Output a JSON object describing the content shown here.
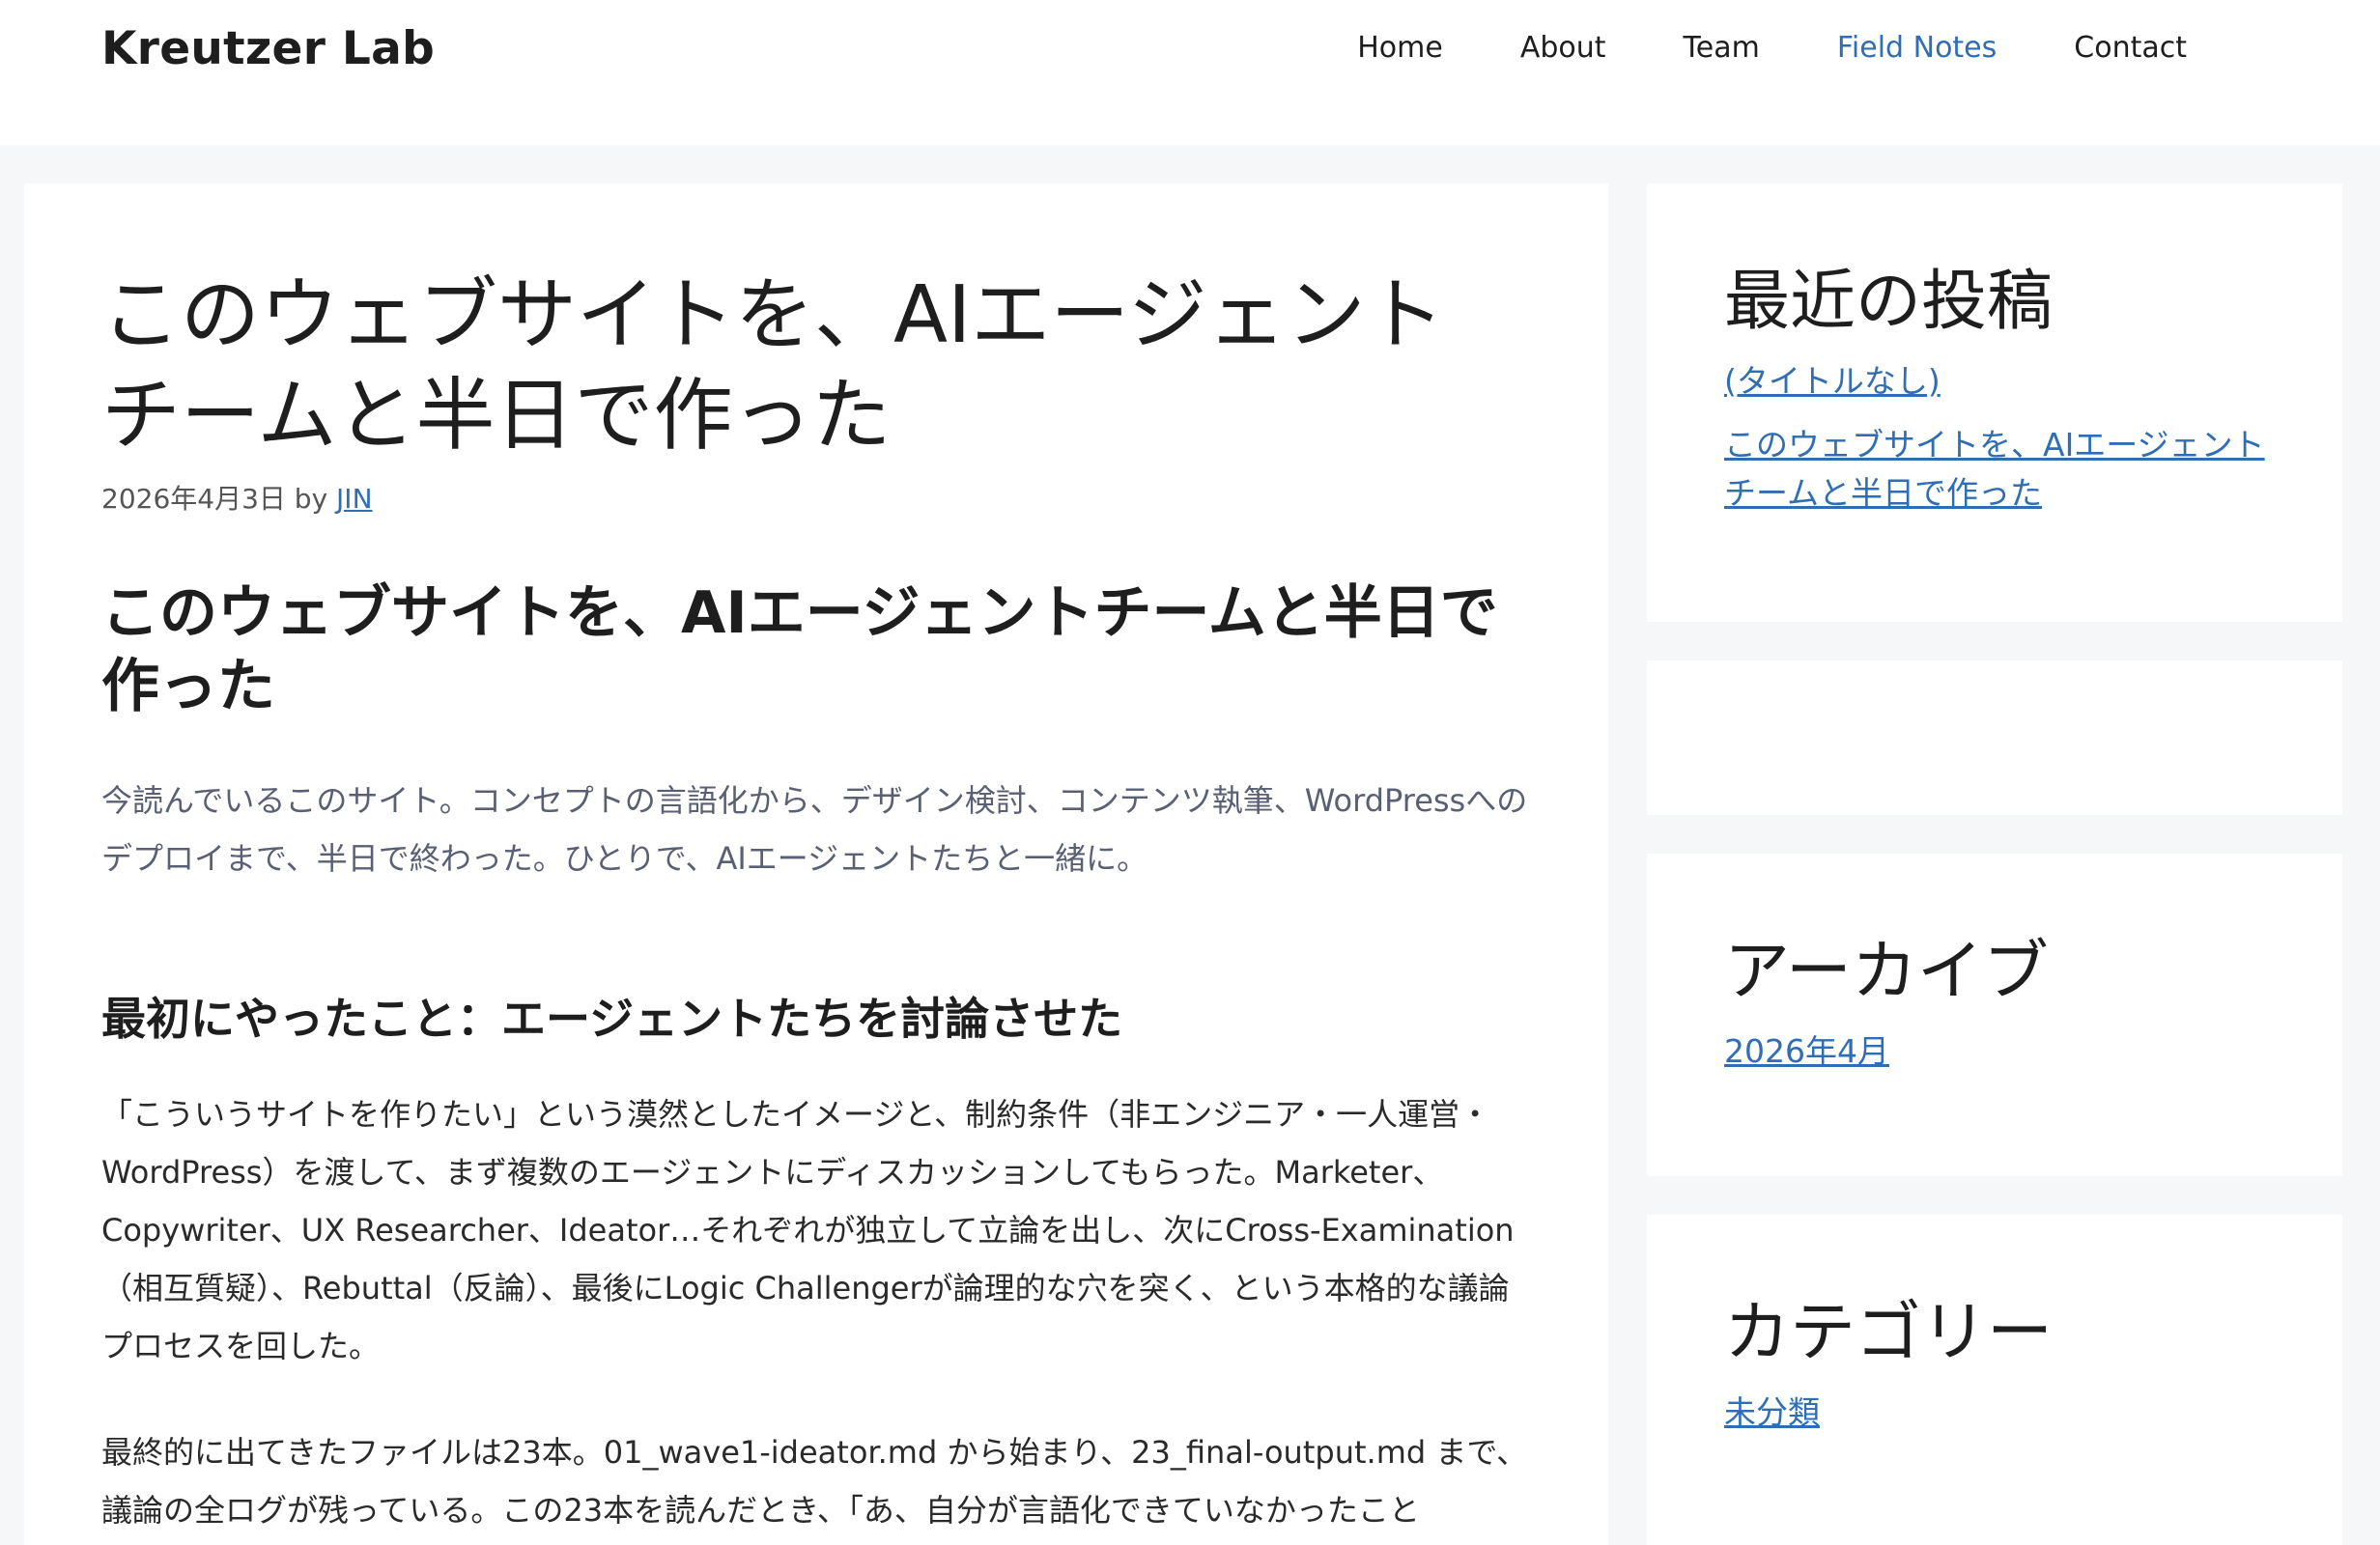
{
  "site": {
    "title": "Kreutzer Lab"
  },
  "nav": {
    "items": [
      {
        "label": "Home",
        "current": false
      },
      {
        "label": "About",
        "current": false
      },
      {
        "label": "Team",
        "current": false
      },
      {
        "label": "Field Notes",
        "current": true
      },
      {
        "label": "Contact",
        "current": false
      }
    ]
  },
  "post": {
    "title": "このウェブサイトを、AIエージェントチームと半日で作った",
    "date": "2026年4月3日",
    "by": "by",
    "author": "JIN",
    "heading": "このウェブサイトを、AIエージェントチームと半日で作った",
    "lead": "今読んでいるこのサイト。コンセプトの言語化から、デザイン検討、コンテンツ執筆、WordPressへのデプロイまで、半日で終わった。ひとりで、AIエージェントたちと一緒に。",
    "section_heading": "最初にやったこと：エージェントたちを討論させた",
    "paragraph1": "「こういうサイトを作りたい」という漠然としたイメージと、制約条件（非エンジニア・一人運営・WordPress）を渡して、まず複数のエージェントにディスカッションしてもらった。Marketer、Copywriter、UX Researcher、Ideator…それぞれが独立して立論を出し、次にCross-Examination（相互質疑）、Rebuttal（反論）、最後にLogic Challengerが論理的な穴を突く、という本格的な議論プロセスを回した。",
    "paragraph2": "最終的に出てきたファイルは23本。01_wave1-ideator.md から始まり、23_final-output.md まで、議論の全ログが残っている。この23本を読んだとき、「あ、自分が言語化できていなかったこと"
  },
  "sidebar": {
    "recent": {
      "title": "最近の投稿",
      "items": [
        "(タイトルなし)",
        "このウェブサイトを、AIエージェントチームと半日で作った"
      ]
    },
    "archives": {
      "title": "アーカイブ",
      "items": [
        "2026年4月"
      ]
    },
    "categories": {
      "title": "カテゴリー",
      "items": [
        "未分類"
      ]
    }
  },
  "colors": {
    "accent": "#2f6db5",
    "page_bg": "#f6f7f9",
    "lead_text": "#5a6074"
  }
}
